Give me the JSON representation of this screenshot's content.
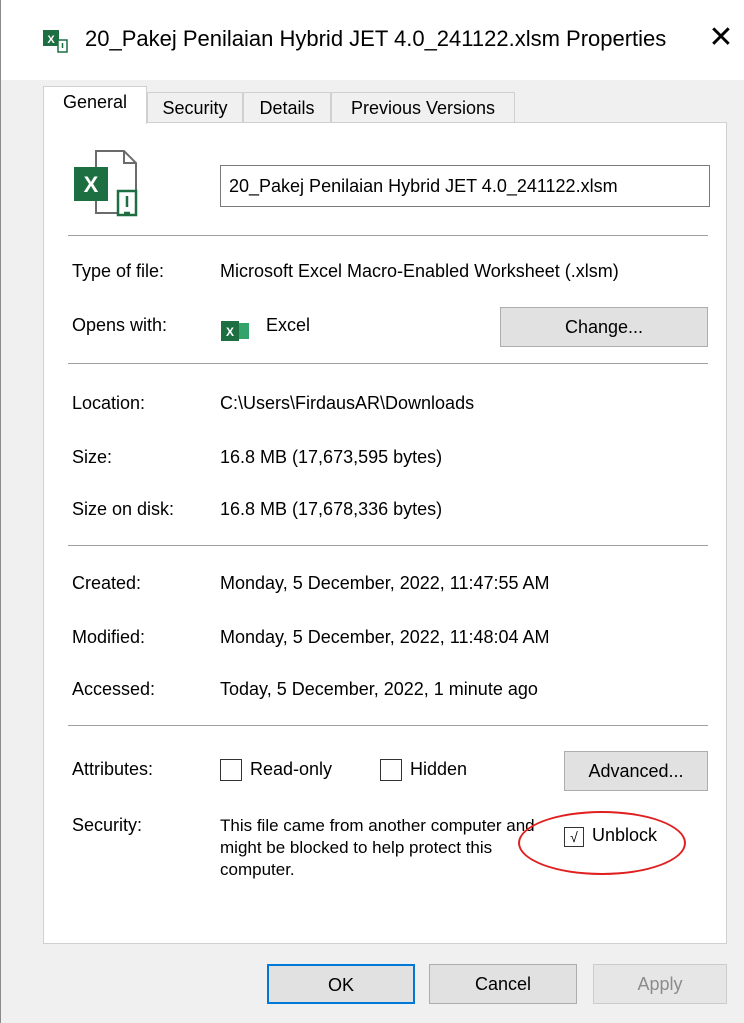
{
  "window": {
    "title": "20_Pakej Penilaian Hybrid JET 4.0_241122.xlsm Properties",
    "close_glyph": "✕"
  },
  "tabs": [
    {
      "label": "General",
      "active": true
    },
    {
      "label": "Security",
      "active": false
    },
    {
      "label": "Details",
      "active": false
    },
    {
      "label": "Previous Versions",
      "active": false
    }
  ],
  "general": {
    "file_name": "20_Pakej Penilaian Hybrid JET 4.0_241122.xlsm",
    "type_label": "Type of file:",
    "type_value": "Microsoft Excel Macro-Enabled Worksheet (.xlsm)",
    "opens_label": "Opens with:",
    "opens_value": "Excel",
    "change_button": "Change...",
    "location_label": "Location:",
    "location_value": "C:\\Users\\FirdausAR\\Downloads",
    "size_label": "Size:",
    "size_value": "16.8 MB (17,673,595 bytes)",
    "size_disk_label": "Size on disk:",
    "size_disk_value": "16.8 MB (17,678,336 bytes)",
    "created_label": "Created:",
    "created_value": "Monday, 5 December, 2022, 11:47:55 AM",
    "modified_label": "Modified:",
    "modified_value": "Monday, 5 December, 2022, 11:48:04 AM",
    "accessed_label": "Accessed:",
    "accessed_value": "Today, 5 December, 2022, 1 minute ago",
    "attributes_label": "Attributes:",
    "readonly_label": "Read-only",
    "hidden_label": "Hidden",
    "advanced_button": "Advanced...",
    "security_label": "Security:",
    "security_text": "This file came from another computer and might be blocked to help protect this computer.",
    "unblock_label": "Unblock",
    "unblock_mark": "√"
  },
  "buttons": {
    "ok": "OK",
    "cancel": "Cancel",
    "apply": "Apply"
  },
  "colors": {
    "excel_green": "#1d6f42",
    "focus_blue": "#0078d7",
    "annotation_red": "#e02020"
  }
}
